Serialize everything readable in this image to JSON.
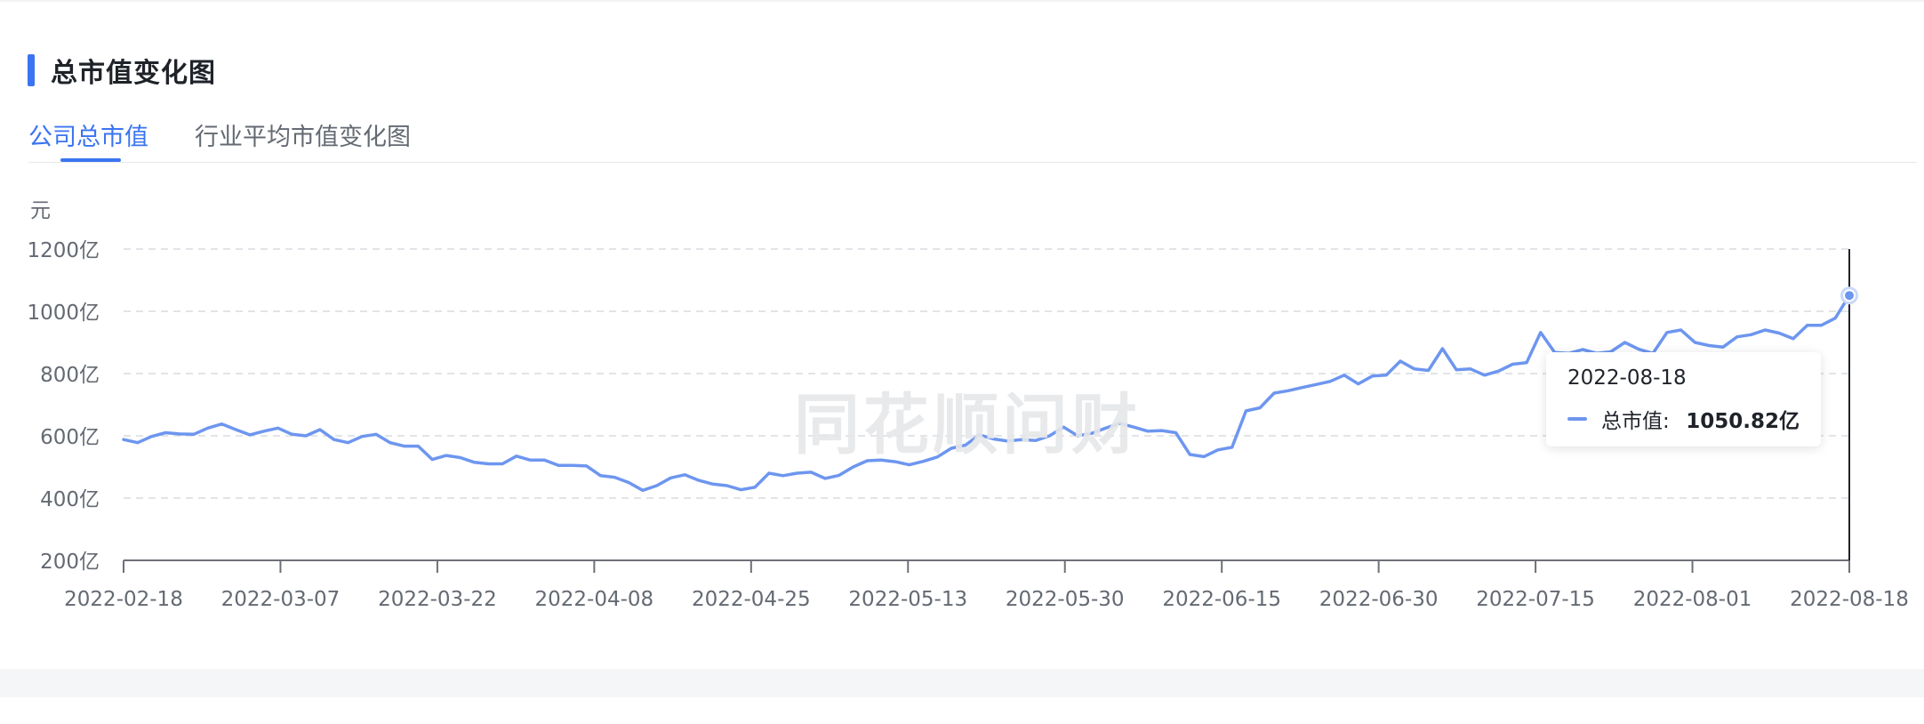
{
  "section": {
    "title": "总市值变化图"
  },
  "tabs": [
    {
      "label": "公司总市值",
      "active": true
    },
    {
      "label": "行业平均市值变化图",
      "active": false
    }
  ],
  "watermark": "同花顺问财",
  "chart_data": {
    "type": "line",
    "unit_label": "元",
    "y_ticks": [
      "200亿",
      "400亿",
      "600亿",
      "800亿",
      "1000亿",
      "1200亿"
    ],
    "ylim": [
      200,
      1200
    ],
    "x_tick_labels": [
      "2022-02-18",
      "2022-03-07",
      "2022-03-22",
      "2022-04-08",
      "2022-04-25",
      "2022-05-13",
      "2022-05-30",
      "2022-06-15",
      "2022-06-30",
      "2022-07-15",
      "2022-08-01",
      "2022-08-18"
    ],
    "grid": "horizontal dashed",
    "series": [
      {
        "name": "总市值",
        "color": "#6d96ef",
        "values": [
          588,
          578,
          598,
          610,
          606,
          605,
          625,
          638,
          620,
          603,
          615,
          625,
          605,
          600,
          620,
          588,
          578,
          598,
          605,
          578,
          567,
          567,
          524,
          537,
          530,
          515,
          510,
          510,
          535,
          522,
          522,
          505,
          505,
          503,
          472,
          467,
          450,
          425,
          440,
          465,
          475,
          457,
          445,
          440,
          427,
          435,
          480,
          472,
          480,
          483,
          463,
          473,
          500,
          520,
          522,
          517,
          507,
          518,
          532,
          560,
          570,
          603,
          590,
          583,
          588,
          585,
          600,
          628,
          600,
          608,
          625,
          640,
          628,
          615,
          617,
          610,
          540,
          533,
          555,
          563,
          680,
          690,
          737,
          745,
          755,
          765,
          775,
          795,
          767,
          792,
          795,
          840,
          815,
          810,
          880,
          812,
          815,
          795,
          808,
          830,
          835,
          932,
          868,
          865,
          877,
          865,
          870,
          900,
          878,
          865,
          932,
          940,
          900,
          890,
          885,
          918,
          925,
          940,
          930,
          912,
          955,
          955,
          978,
          1050.82
        ]
      }
    ],
    "tooltip": {
      "date": "2022-08-18",
      "label": "总市值:",
      "value": "1050.82亿"
    }
  }
}
